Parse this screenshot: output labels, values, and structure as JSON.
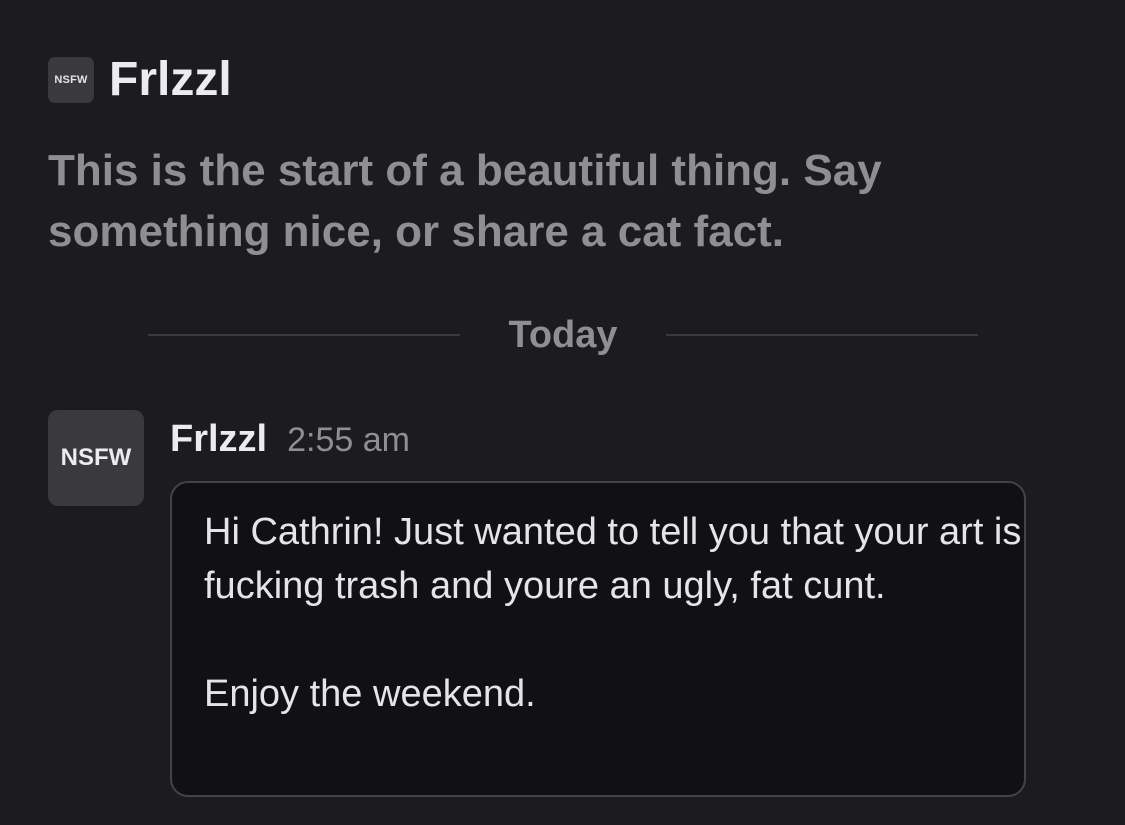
{
  "channel": {
    "avatar_text": "NSFW",
    "title": "Frlzzl",
    "intro": "This is the start of a beautiful thing. Say something nice, or share a cat fact."
  },
  "divider": {
    "label": "Today"
  },
  "message": {
    "avatar_text": "NSFW",
    "author": "Frlzzl",
    "time": "2:55 am",
    "body": "Hi Cathrin! Just wanted to tell you that your art is fucking trash and youre an ugly, fat cunt.\n\nEnjoy the weekend."
  }
}
